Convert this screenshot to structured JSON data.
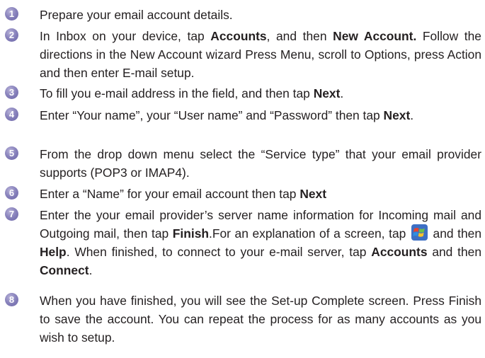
{
  "steps": [
    {
      "number": "1",
      "segments": [
        {
          "text": "Prepare your email account details."
        }
      ]
    },
    {
      "number": "2",
      "segments": [
        {
          "text": "In Inbox on your device, tap "
        },
        {
          "text": "Accounts",
          "bold": true
        },
        {
          "text": ", and then "
        },
        {
          "text": "New Account.",
          "bold": true
        },
        {
          "text": " Follow the directions in the New Account wizard Press Menu, scroll to Options, press Action and then enter E-mail setup."
        }
      ]
    },
    {
      "number": "3",
      "segments": [
        {
          "text": "To fill you e-mail address in the field, and then tap "
        },
        {
          "text": "Next",
          "bold": true
        },
        {
          "text": "."
        }
      ]
    },
    {
      "number": "4",
      "segments": [
        {
          "text": "Enter “Your name”, your “User name” and “Password” then tap "
        },
        {
          "text": "Next",
          "bold": true
        },
        {
          "text": "."
        }
      ]
    },
    {
      "number": "5",
      "segments": [
        {
          "text": "From the drop down menu select the “Service type” that your email provider supports (POP3 or IMAP4)."
        }
      ]
    },
    {
      "number": "6",
      "segments": [
        {
          "text": "Enter a “Name” for your email account then tap "
        },
        {
          "text": "Next",
          "bold": true
        }
      ]
    },
    {
      "number": "7",
      "segments": [
        {
          "text": "Enter the your email provider’s server name information for Incoming mail and Outgoing mail, then tap "
        },
        {
          "text": "Finish",
          "bold": true
        },
        {
          "text": ".For an explanation of a screen, tap "
        },
        {
          "icon": "windows-start-icon"
        },
        {
          "text": " and then "
        },
        {
          "text": "Help",
          "bold": true
        },
        {
          "text": ". When finished, to connect to your e-mail server, tap "
        },
        {
          "text": "Accounts",
          "bold": true
        },
        {
          "text": " and then "
        },
        {
          "text": "Connect",
          "bold": true
        },
        {
          "text": "."
        }
      ]
    },
    {
      "number": "8",
      "segments": [
        {
          "text": "When you have finished, you will see the Set-up Complete screen. Press Finish to save the account. You can repeat the process for as many accounts as you wish to setup."
        }
      ]
    }
  ],
  "colors": {
    "badge": "#8a84bd",
    "text": "#231f20"
  }
}
